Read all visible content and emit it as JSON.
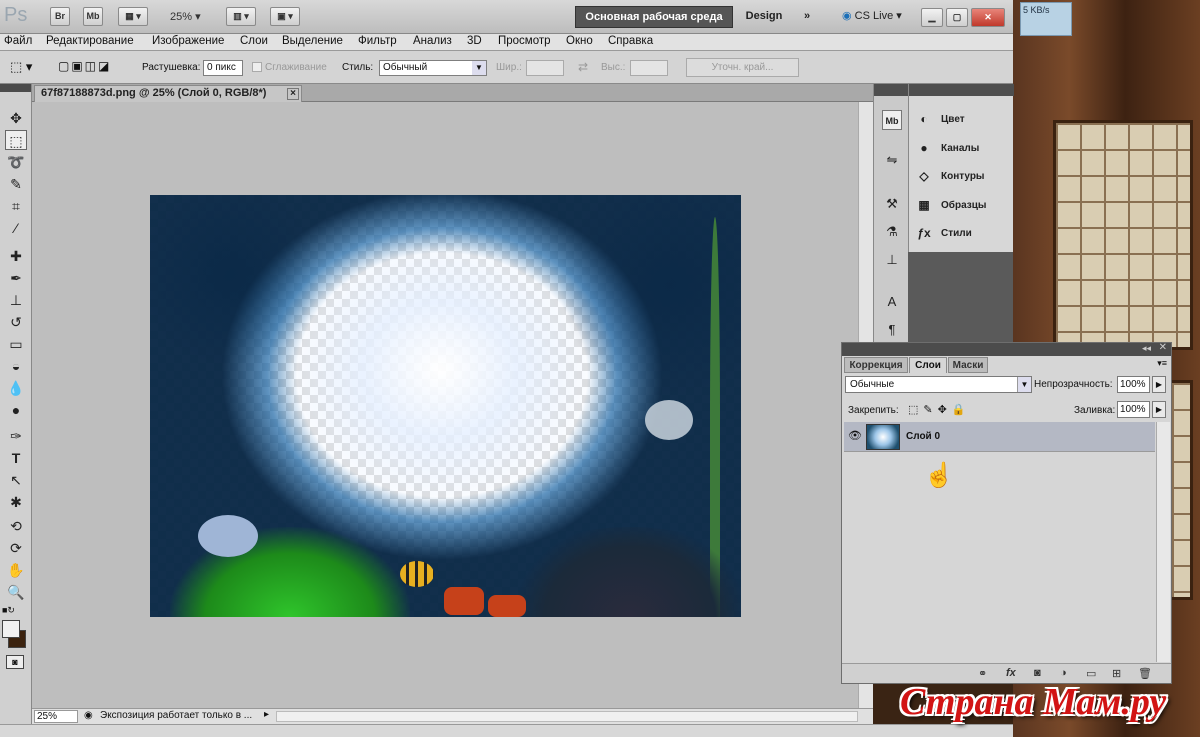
{
  "appbar": {
    "logo": "Ps",
    "br": "Br",
    "mb": "Mb",
    "zoom": "25%",
    "workspace": "Основная рабочая среда",
    "design": "Design",
    "more": "»",
    "cslive": "CS Live",
    "netw_speed": "5 KB/s"
  },
  "menu": [
    "Файл",
    "Редактирование",
    "Изображение",
    "Слои",
    "Выделение",
    "Фильтр",
    "Анализ",
    "3D",
    "Просмотр",
    "Окно",
    "Справка"
  ],
  "options": {
    "feather_label": "Растушевка:",
    "feather_value": "0 пикс",
    "antialias_label": "Сглаживание",
    "style_label": "Стиль:",
    "style_value": "Обычный",
    "width_label": "Шир.:",
    "height_label": "Выс.:",
    "refine_button": "Уточн. край..."
  },
  "document": {
    "tab_title": "67f87188873d.png @ 25% (Слой 0, RGB/8*)",
    "close": "×"
  },
  "status": {
    "zoom": "25%",
    "info": "Экспозиция работает только в ..."
  },
  "dock": {
    "panels": [
      {
        "label": "Цвет",
        "icon": "color-icon"
      },
      {
        "label": "Каналы",
        "icon": "channels-icon"
      },
      {
        "label": "Контуры",
        "icon": "paths-icon"
      },
      {
        "label": "Образцы",
        "icon": "swatches-icon"
      },
      {
        "label": "Стили",
        "icon": "styles-icon"
      }
    ]
  },
  "layers_panel": {
    "tabs": [
      "Коррекция",
      "Слои",
      "Маски"
    ],
    "active_tab": "Слои",
    "blend_mode": "Обычные",
    "opacity_label": "Непрозрачность:",
    "opacity_value": "100%",
    "lock_label": "Закрепить:",
    "fill_label": "Заливка:",
    "fill_value": "100%",
    "layer_name": "Слой 0"
  },
  "watermark": "Страна Мам.ру"
}
